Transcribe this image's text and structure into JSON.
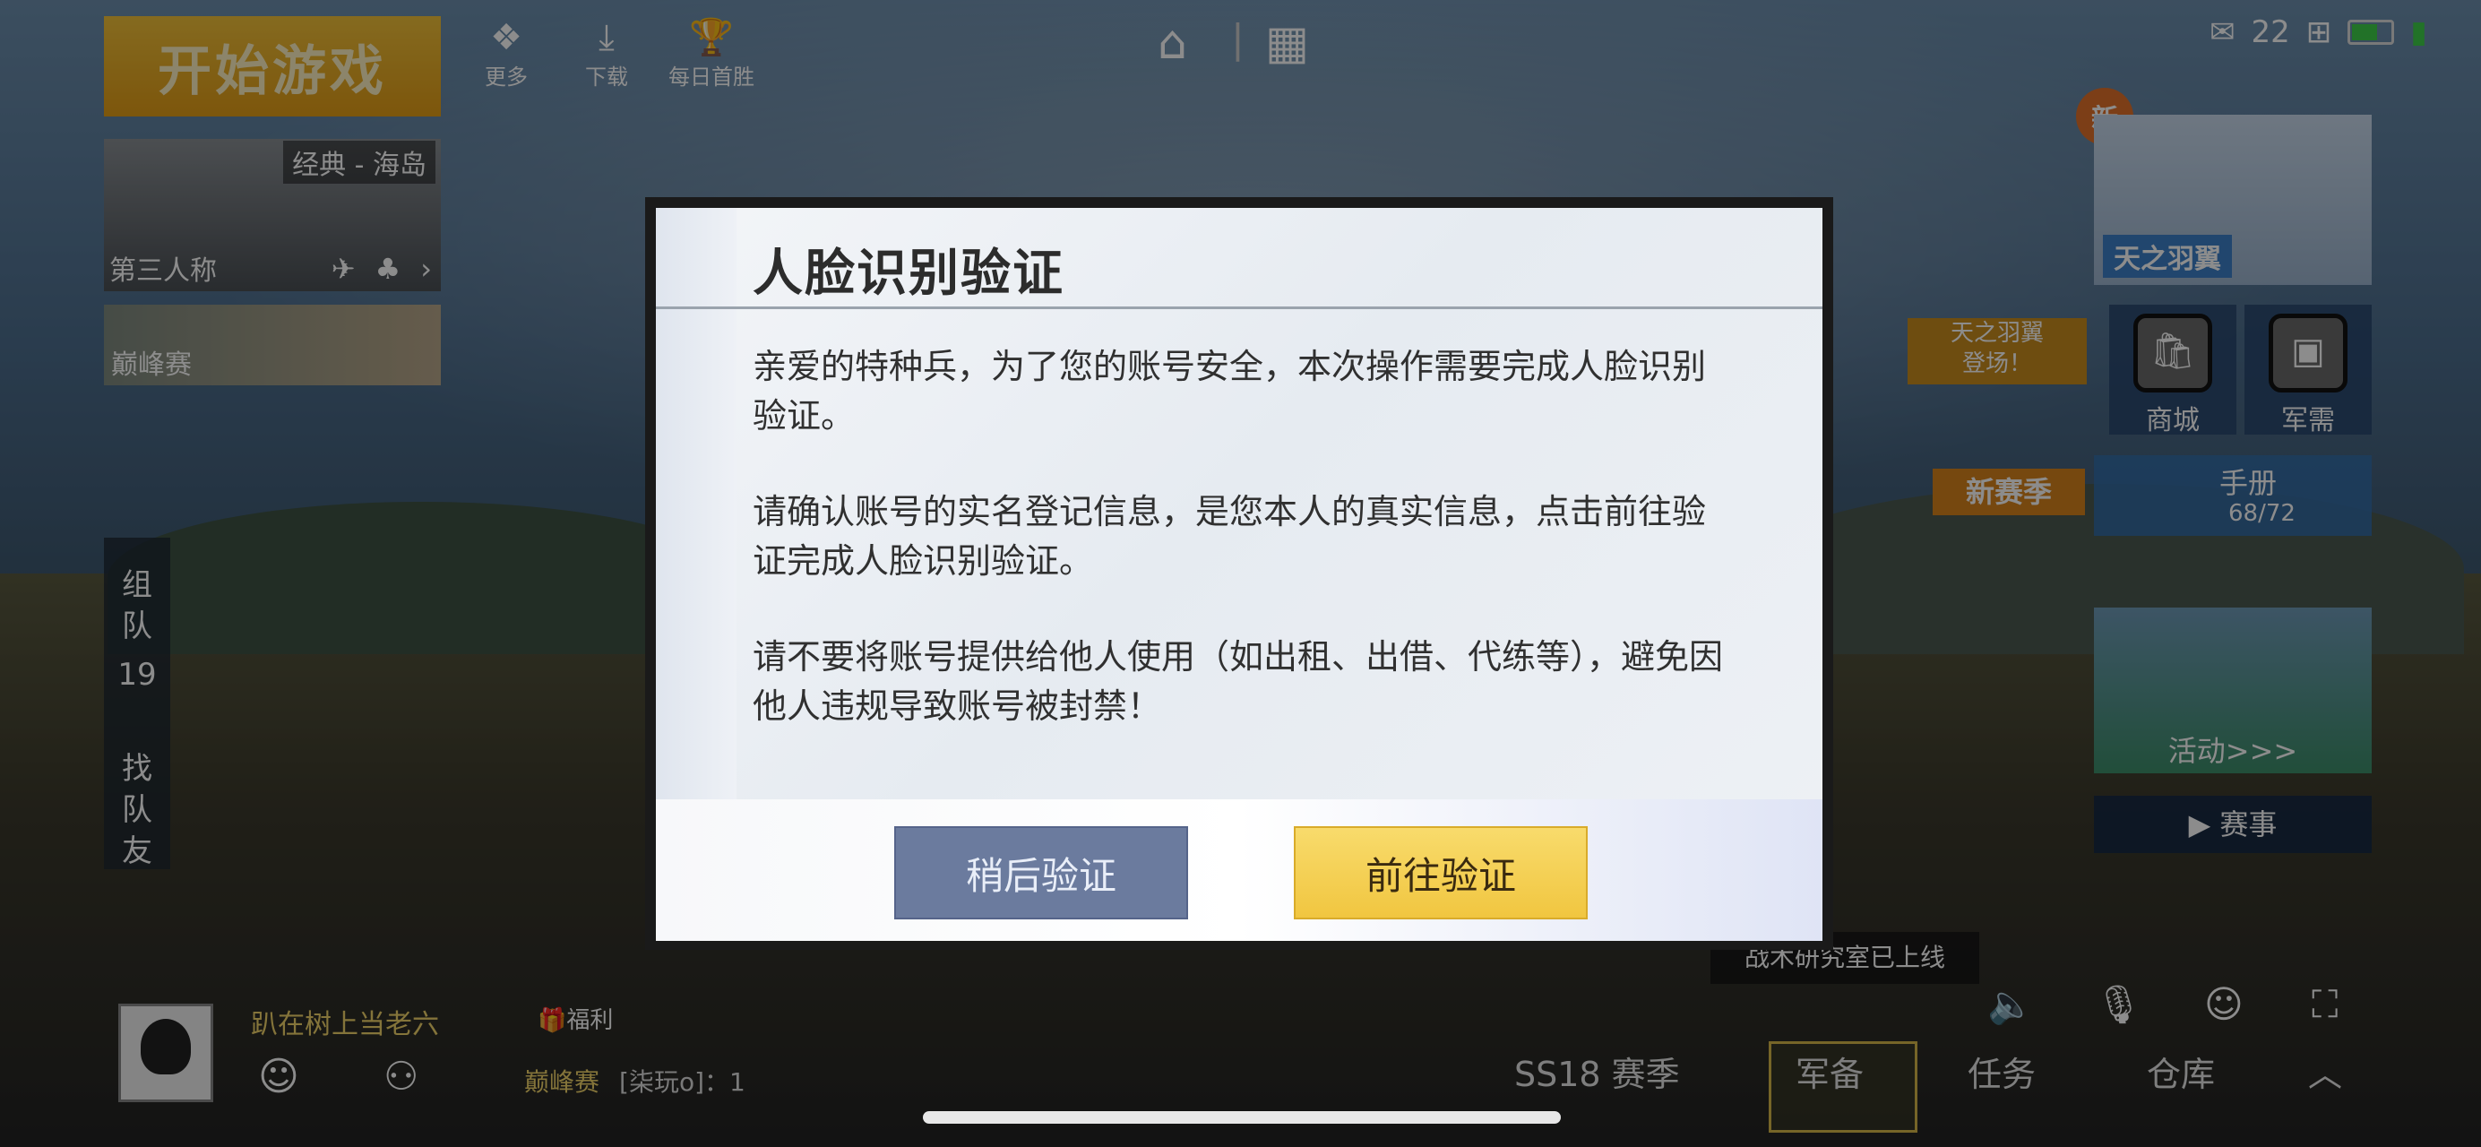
{
  "top_left": {
    "start_game": "开始游戏",
    "mode": {
      "title": "经典 - 海岛",
      "view": "第三人称"
    },
    "peak": "巅峰赛",
    "icons": [
      {
        "label": "更多",
        "icon": "more-icon"
      },
      {
        "label": "下载",
        "icon": "download-icon"
      },
      {
        "label": "每日首胜",
        "icon": "daily-win-icon"
      }
    ]
  },
  "status_bar": {
    "notifications": "22"
  },
  "right_panel": {
    "new_badge": "新",
    "feather_title": "天之羽翼",
    "feather_tip": "天之羽翼\n登场！",
    "shop": "商城",
    "armory": "军需",
    "new_season": "新赛季",
    "manual": {
      "label": "手册",
      "progress": "68/72"
    },
    "activity": "活动>>>",
    "events": "赛事",
    "lab_notice": "战术研究室已上线"
  },
  "left_bar": {
    "team": "组\n队",
    "team_count": "19",
    "find": "找\n队\n友"
  },
  "bottom": {
    "player_name": "趴在树上当老六",
    "welfare": "福利",
    "peak_label": "巅峰赛",
    "peak_value": "[柒玩o]：1",
    "nav": [
      "SS18 赛季",
      "军备",
      "任务",
      "仓库"
    ]
  },
  "dialog": {
    "title": "人脸识别验证",
    "paragraphs": [
      "亲爱的特种兵，为了您的账号安全，本次操作需要完成人脸识别验证。",
      "请确认账号的实名登记信息，是您本人的真实信息，点击前往验证完成人脸识别验证。",
      "请不要将账号提供给他人使用（如出租、出借、代练等），避免因他人违规导致账号被封禁！"
    ],
    "later_button": "稍后验证",
    "go_button": "前往验证"
  }
}
